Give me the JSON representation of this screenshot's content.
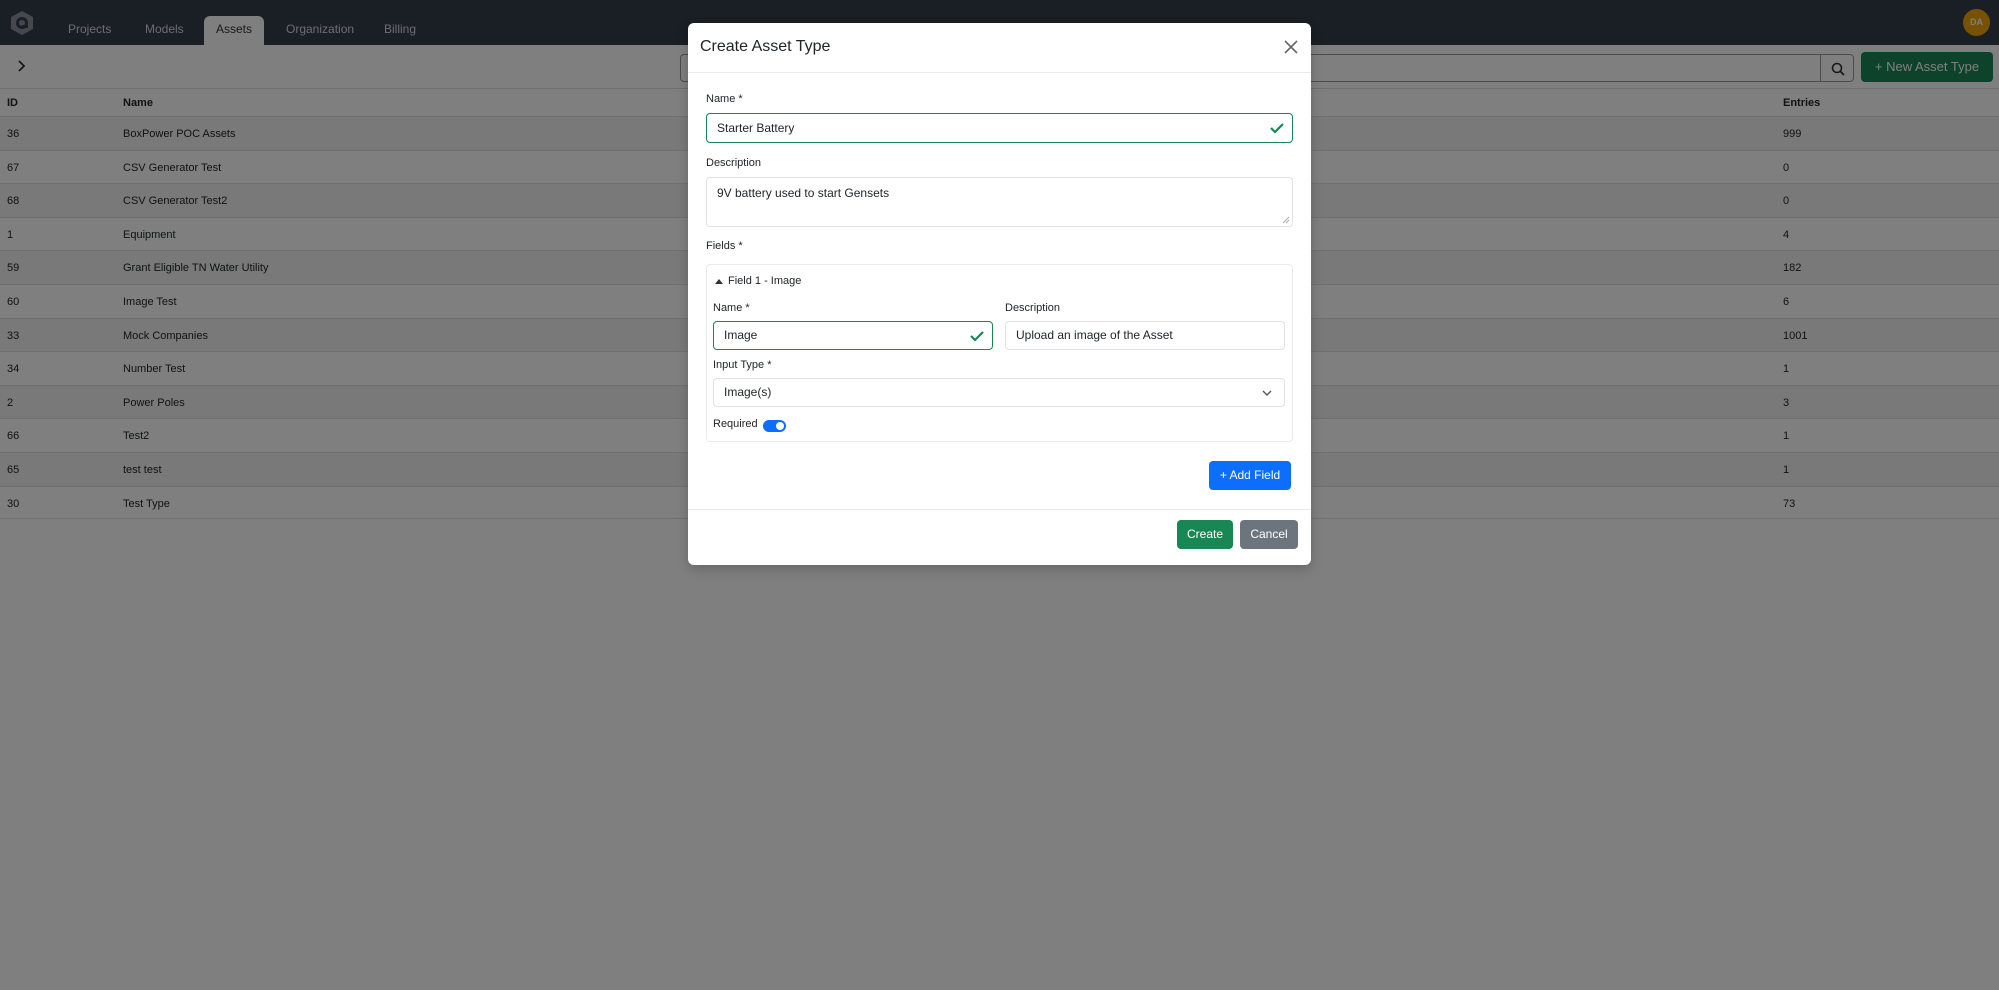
{
  "nav": {
    "tabs": [
      {
        "label": "Projects",
        "active": false
      },
      {
        "label": "Models",
        "active": false
      },
      {
        "label": "Assets",
        "active": true
      },
      {
        "label": "Organization",
        "active": false
      },
      {
        "label": "Billing",
        "active": false
      }
    ],
    "avatar_initials": "DA",
    "avatar_color": "#f0a400"
  },
  "toolbar": {
    "search_placeholder": "",
    "new_button_label": "+ New Asset Type",
    "brand_color": "#198754"
  },
  "table": {
    "columns": {
      "id": "ID",
      "name": "Name",
      "entries": "Entries"
    },
    "rows": [
      {
        "id": "36",
        "name": "BoxPower POC Assets",
        "entries": "999"
      },
      {
        "id": "67",
        "name": "CSV Generator Test",
        "entries": "0"
      },
      {
        "id": "68",
        "name": "CSV Generator Test2",
        "entries": "0"
      },
      {
        "id": "1",
        "name": "Equipment",
        "entries": "4"
      },
      {
        "id": "59",
        "name": "Grant Eligible TN Water Utility",
        "entries": "182"
      },
      {
        "id": "60",
        "name": "Image Test",
        "entries": "6"
      },
      {
        "id": "33",
        "name": "Mock Companies",
        "entries": "1001"
      },
      {
        "id": "34",
        "name": "Number Test",
        "entries": "1"
      },
      {
        "id": "2",
        "name": "Power Poles",
        "entries": "3"
      },
      {
        "id": "66",
        "name": "Test2",
        "entries": "1"
      },
      {
        "id": "65",
        "name": "test test",
        "entries": "1"
      },
      {
        "id": "30",
        "name": "Test Type",
        "entries": "73"
      }
    ]
  },
  "modal": {
    "title": "Create Asset Type",
    "name_label": "Name *",
    "name_value": "Starter Battery",
    "description_label": "Description",
    "description_value": "9V battery used to start Gensets",
    "fields_label": "Fields *",
    "fields": [
      {
        "header": "Field 1 - Image",
        "name_label": "Name *",
        "name_value": "Image",
        "description_label": "Description",
        "description_value": "Upload an image of the Asset",
        "input_type_label": "Input Type *",
        "input_type_value": "Image(s)",
        "required_label": "Required",
        "required": true
      }
    ],
    "add_field_label": "+ Add Field",
    "create_label": "Create",
    "cancel_label": "Cancel"
  }
}
